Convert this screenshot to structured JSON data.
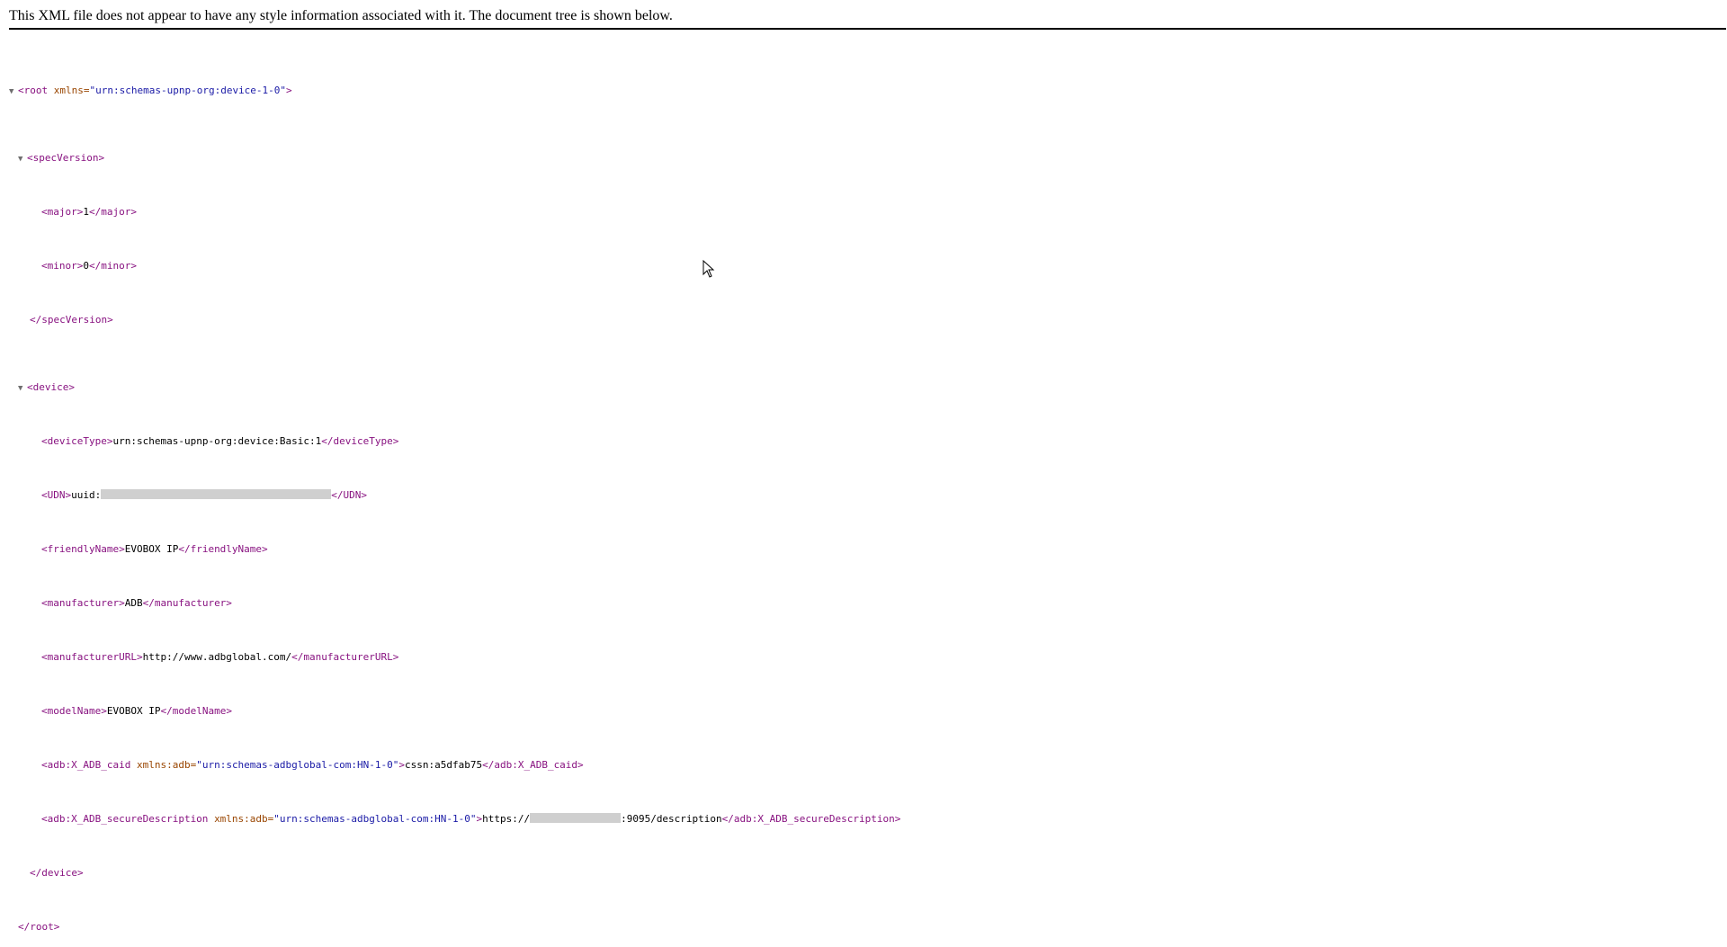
{
  "header": {
    "message": "This XML file does not appear to have any style information associated with it. The document tree is shown below."
  },
  "tree": {
    "toggle_glyph": "▼",
    "root_open": "<root",
    "root_attr_name": "xmlns=",
    "root_attr_value": "\"urn:schemas-upnp-org:device-1-0\"",
    "root_open_end": ">",
    "specVersion_open": "<specVersion>",
    "major_open": "<major>",
    "major_value": "1",
    "major_close": "</major>",
    "minor_open": "<minor>",
    "minor_value": "0",
    "minor_close": "</minor>",
    "specVersion_close": "</specVersion>",
    "device_open": "<device>",
    "deviceType_open": "<deviceType>",
    "deviceType_value": "urn:schemas-upnp-org:device:Basic:1",
    "deviceType_close": "</deviceType>",
    "udn_open": "<UDN>",
    "udn_value_prefix": "uuid:",
    "udn_close": "</UDN>",
    "friendlyName_open": "<friendlyName>",
    "friendlyName_value": "EVOBOX IP",
    "friendlyName_close": "</friendlyName>",
    "manufacturer_open": "<manufacturer>",
    "manufacturer_value": "ADB",
    "manufacturer_close": "</manufacturer>",
    "manufacturerURL_open": "<manufacturerURL>",
    "manufacturerURL_value": "http://www.adbglobal.com/",
    "manufacturerURL_close": "</manufacturerURL>",
    "modelName_open": "<modelName>",
    "modelName_value": "EVOBOX IP",
    "modelName_close": "</modelName>",
    "caid_open": "<adb:X_ADB_caid",
    "caid_attr_name": "xmlns:adb=",
    "caid_attr_value": "\"urn:schemas-adbglobal-com:HN-1-0\"",
    "caid_open_end": ">",
    "caid_value": "cssn:a5dfab75",
    "caid_close": "</adb:X_ADB_caid>",
    "secdesc_open": "<adb:X_ADB_secureDescription",
    "secdesc_attr_name": "xmlns:adb=",
    "secdesc_attr_value": "\"urn:schemas-adbglobal-com:HN-1-0\"",
    "secdesc_open_end": ">",
    "secdesc_value_prefix": "https://",
    "secdesc_value_suffix": ":9095/description",
    "secdesc_close": "</adb:X_ADB_secureDescription>",
    "device_close": "</device>",
    "root_close": "</root>"
  },
  "colors": {
    "tag": "#881280",
    "attr_name": "#994500",
    "attr_value": "#1a1aa6",
    "redaction": "#cfcfcf"
  }
}
